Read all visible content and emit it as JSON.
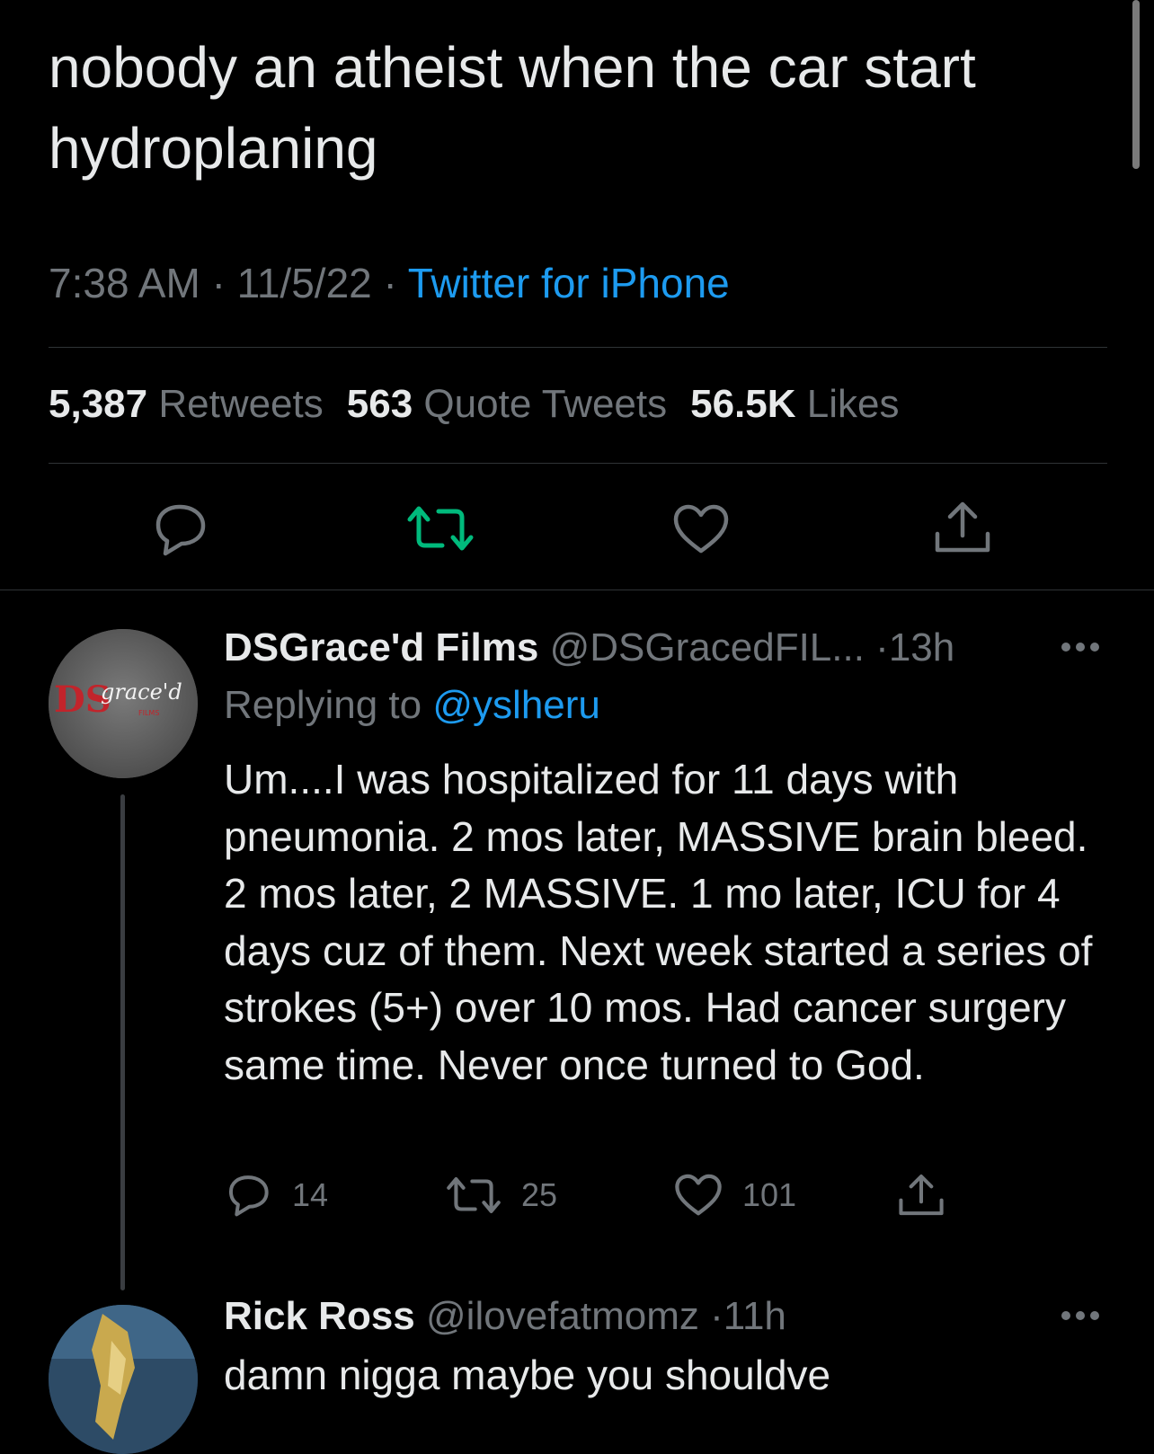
{
  "tweet": {
    "text": "nobody an atheist when the car start hydroplaning",
    "time": "7:38 AM",
    "date": "11/5/22",
    "source": "Twitter for iPhone",
    "sep": "·",
    "stats": {
      "retweets_count": "5,387",
      "retweets_label": "Retweets",
      "quotes_count": "563",
      "quotes_label": "Quote Tweets",
      "likes_count": "56.5K",
      "likes_label": "Likes"
    }
  },
  "replies": [
    {
      "name": "DSGrace'd Films",
      "handle": "@DSGracedFIL...",
      "age": "13h",
      "replying_prefix": "Replying to",
      "replying_to": "@yslheru",
      "avatar_text": "DS",
      "avatar_script": "grace'd",
      "avatar_sub": "FILMS",
      "text": "Um....I was hospitalized for 11 days with pneumonia. 2 mos later, MASSIVE brain bleed. 2 mos later, 2 MASSIVE.  1 mo later, ICU for 4 days cuz of them.  Next week started a series of strokes (5+) over 10 mos. Had cancer surgery same time. Never once turned to God.",
      "reply_count": "14",
      "retweet_count": "25",
      "like_count": "101"
    },
    {
      "name": "Rick Ross",
      "handle": "@ilovefatmomz",
      "age": "11h",
      "text": "damn nigga maybe you shouldve"
    }
  ],
  "colors": {
    "background": "#000000",
    "text": "#e7e9ea",
    "muted": "#71767b",
    "link": "#1d9bf0",
    "retweet_active": "#00ba7c"
  },
  "icons": {
    "reply": "speech-bubble-icon",
    "retweet": "retweet-arrows-icon",
    "like": "heart-icon",
    "share": "share-upload-icon",
    "more": "more-dots-icon"
  }
}
